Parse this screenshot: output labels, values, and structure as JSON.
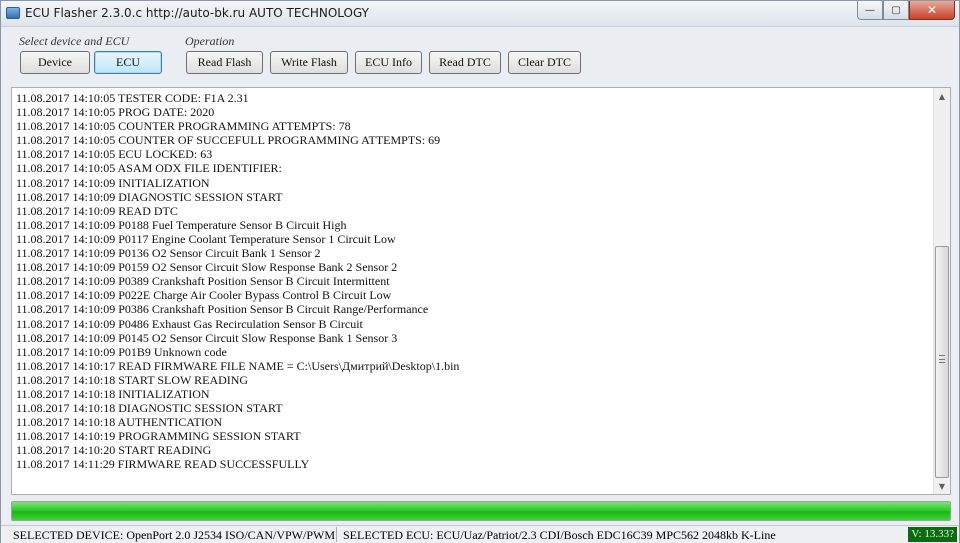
{
  "window": {
    "title": "ECU Flasher 2.3.0.c  http://auto-bk.ru  AUTO TECHNOLOGY",
    "controls": {
      "minimize": "—",
      "maximize": "▢",
      "close": "✕"
    }
  },
  "select_group": {
    "label": "Select device and ECU",
    "device_button": "Device",
    "ecu_button": "ECU"
  },
  "operation_group": {
    "label": "Operation",
    "buttons": [
      "Read Flash",
      "Write Flash",
      "ECU Info",
      "Read DTC",
      "Clear DTC"
    ]
  },
  "log": {
    "lines": [
      "11.08.2017 14:10:05 TESTER CODE: F1A 2.31",
      "11.08.2017 14:10:05 PROG DATE: 2020",
      "11.08.2017 14:10:05 COUNTER PROGRAMMING ATTEMPTS: 78",
      "11.08.2017 14:10:05 COUNTER OF SUCCEFULL PROGRAMMING ATTEMPTS: 69",
      "11.08.2017 14:10:05 ECU LOCKED: 63",
      "11.08.2017 14:10:05 ASAM ODX FILE IDENTIFIER:",
      "11.08.2017 14:10:09 INITIALIZATION",
      "11.08.2017 14:10:09 DIAGNOSTIC SESSION START",
      "11.08.2017 14:10:09 READ DTC",
      "11.08.2017 14:10:09 P0188 Fuel Temperature Sensor B Circuit High",
      "11.08.2017 14:10:09 P0117 Engine Coolant Temperature Sensor 1 Circuit Low",
      "11.08.2017 14:10:09 P0136 O2 Sensor Circuit Bank 1 Sensor 2",
      "11.08.2017 14:10:09 P0159 O2 Sensor Circuit Slow Response Bank 2 Sensor 2",
      "11.08.2017 14:10:09 P0389 Crankshaft Position Sensor B Circuit Intermittent",
      "11.08.2017 14:10:09 P022E Charge Air Cooler Bypass Control B Circuit Low",
      "11.08.2017 14:10:09 P0386 Crankshaft Position Sensor B Circuit Range/Performance",
      "11.08.2017 14:10:09 P0486 Exhaust Gas Recirculation Sensor B Circuit",
      "11.08.2017 14:10:09 P0145 O2 Sensor Circuit Slow Response Bank 1 Sensor 3",
      "11.08.2017 14:10:09 P01B9 Unknown code",
      "11.08.2017 14:10:17 READ FIRMWARE FILE NAME = C:\\Users\\Дмитрий\\Desktop\\1.bin",
      "11.08.2017 14:10:18 START SLOW READING",
      "11.08.2017 14:10:18 INITIALIZATION",
      "11.08.2017 14:10:18 DIAGNOSTIC SESSION START",
      "11.08.2017 14:10:18 AUTHENTICATION",
      "11.08.2017 14:10:19 PROGRAMMING SESSION START",
      "11.08.2017 14:10:20 START READING",
      "11.08.2017 14:11:29 FIRMWARE READ SUCCESSFULLY"
    ],
    "scrollbar": {
      "up_icon": "▲",
      "down_icon": "▼"
    }
  },
  "progress": {
    "percent": 100,
    "color": "#22c11e"
  },
  "status": {
    "device": "SELECTED DEVICE: OpenPort 2.0 J2534 ISO/CAN/VPW/PWM",
    "ecu": "SELECTED ECU: ECU/Uaz/Patriot/2.3 CDI/Bosch EDC16C39 MPC562 2048kb K-Line",
    "version": "V: 13.33?"
  }
}
